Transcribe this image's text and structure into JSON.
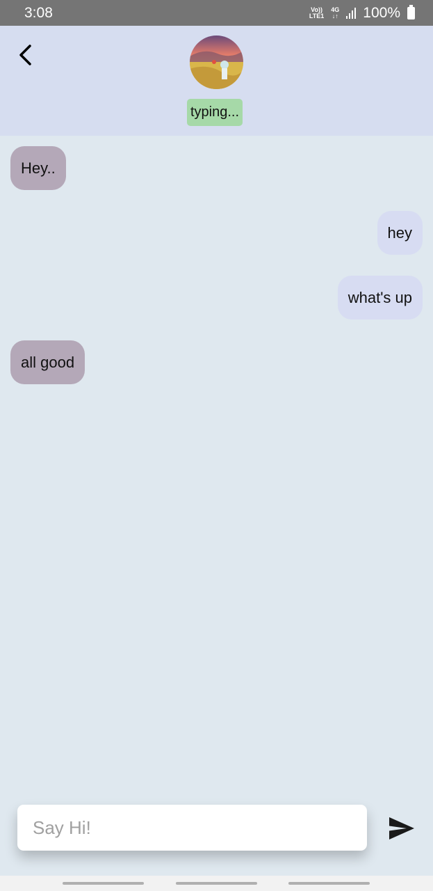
{
  "status_bar": {
    "time": "3:08",
    "volte_top": "Vo))",
    "volte_bottom": "LTE1",
    "network": "4G",
    "battery": "100%"
  },
  "header": {
    "status_text": "typing...",
    "avatar_icon": "avatar-image",
    "back_icon": "chevron-left-icon"
  },
  "messages": [
    {
      "text": "Hey..",
      "direction": "received"
    },
    {
      "text": "hey",
      "direction": "sent"
    },
    {
      "text": "what's up",
      "direction": "sent"
    },
    {
      "text": "all good",
      "direction": "received"
    }
  ],
  "composer": {
    "placeholder": "Say Hi!",
    "value": "",
    "send_icon": "send-icon"
  },
  "colors": {
    "background": "#dfe8ef",
    "header": "#d6ddf0",
    "received_bubble": "#b4a8b8",
    "sent_bubble": "#d7dcf2",
    "typing_badge": "#a6d9a8"
  }
}
